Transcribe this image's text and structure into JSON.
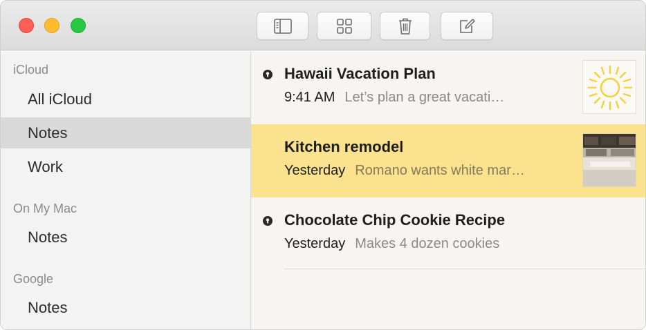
{
  "window": {
    "controls": [
      "close",
      "minimize",
      "zoom"
    ]
  },
  "toolbar": {
    "buttons": [
      {
        "name": "sidebar-toggle",
        "icon": "sidebar-icon"
      },
      {
        "name": "gallery-view",
        "icon": "grid-icon"
      },
      {
        "name": "delete",
        "icon": "trash-icon"
      },
      {
        "name": "new-note",
        "icon": "compose-icon"
      }
    ]
  },
  "sidebar": {
    "sections": [
      {
        "title": "iCloud",
        "items": [
          {
            "label": "All iCloud"
          },
          {
            "label": "Notes",
            "selected": true
          },
          {
            "label": "Work"
          }
        ]
      },
      {
        "title": "On My Mac",
        "items": [
          {
            "label": "Notes"
          }
        ]
      },
      {
        "title": "Google",
        "items": [
          {
            "label": "Notes"
          }
        ]
      }
    ]
  },
  "notes": [
    {
      "title": "Hawaii Vacation Plan",
      "date": "9:41 AM",
      "preview": "Let’s plan a great vacati…",
      "pinned": true,
      "thumbnail": "sun-icon"
    },
    {
      "title": "Kitchen remodel",
      "date": "Yesterday",
      "preview": "Romano wants white mar…",
      "pinned": false,
      "selected": true,
      "thumbnail": "kitchen-photo"
    },
    {
      "title": "Chocolate Chip Cookie Recipe",
      "date": "Yesterday",
      "preview": "Makes 4 dozen cookies",
      "pinned": true
    }
  ],
  "colors": {
    "selected_note": "#fae28e",
    "selected_sidebar": "#d9d9d9",
    "sun_yellow": "#f5d23a"
  }
}
